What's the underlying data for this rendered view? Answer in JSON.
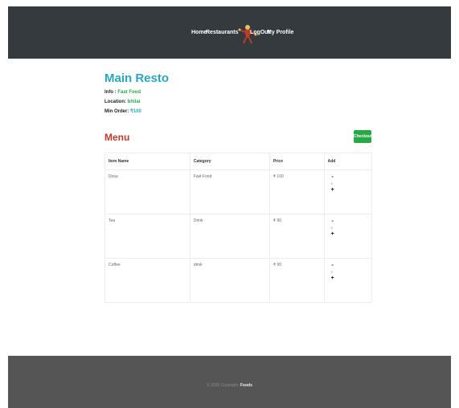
{
  "nav": {
    "home": "Home",
    "restaurants": "Restaurants",
    "logout": "LogOut",
    "profile": "My Profile",
    "logo_icon": "chef-mascot-icon"
  },
  "restaurant": {
    "name": "Main Resto",
    "info_label": "Info :",
    "info_value": "Fast Food",
    "location_label": "Location:",
    "location_value": "bhilai",
    "min_order_label": "Min Order:",
    "min_order_value": "₹100"
  },
  "menu": {
    "title": "Menu",
    "checkout_label": "Checkout",
    "columns": [
      "Item Name",
      "Category",
      "Price",
      "Add"
    ],
    "items": [
      {
        "name": "Dosa",
        "category": "Fast Food",
        "price": "₹ 100",
        "qty": "0"
      },
      {
        "name": "Tea",
        "category": "Drink",
        "price": "₹ 90",
        "qty": "0"
      },
      {
        "name": "Coffee",
        "category": "drink",
        "price": "₹ 90",
        "qty": "0"
      }
    ],
    "minus": "-",
    "plus": "+"
  },
  "footer": {
    "text": "© 2020 Copyright:",
    "brand": "Foods"
  },
  "colors": {
    "header_bg": "#353a3f",
    "footer_bg": "#555555",
    "title": "#2aa6bf",
    "menu_title": "#c0392b",
    "accent_green": "#28a745"
  }
}
